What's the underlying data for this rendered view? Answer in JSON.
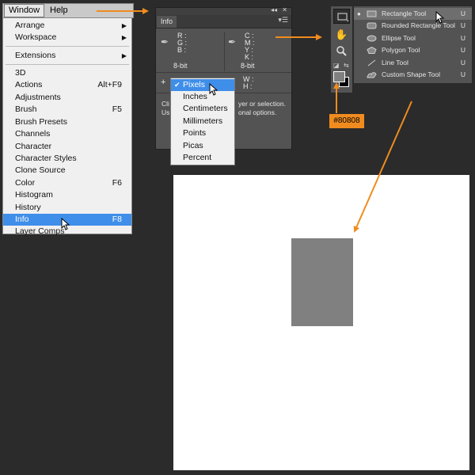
{
  "menubar": {
    "window": "Window",
    "help": "Help"
  },
  "window_menu": {
    "items": [
      {
        "label": "Arrange",
        "underline": "A",
        "submenu": true
      },
      {
        "label": "Workspace",
        "underline": "k",
        "submenu": true
      },
      {
        "label": "Extensions",
        "submenu": true
      },
      {
        "label": "3D"
      },
      {
        "label": "Actions",
        "shortcut": "Alt+F9"
      },
      {
        "label": "Adjustments"
      },
      {
        "label": "Brush",
        "shortcut": "F5"
      },
      {
        "label": "Brush Presets"
      },
      {
        "label": "Channels"
      },
      {
        "label": "Character"
      },
      {
        "label": "Character Styles"
      },
      {
        "label": "Clone Source"
      },
      {
        "label": "Color",
        "shortcut": "F6"
      },
      {
        "label": "Histogram"
      },
      {
        "label": "History"
      },
      {
        "label": "Info",
        "shortcut": "F8",
        "selected": true
      },
      {
        "label": "Layer Comps"
      }
    ]
  },
  "info_panel": {
    "tab": "Info",
    "rgb": {
      "r": "R :",
      "g": "G :",
      "b": "B :"
    },
    "cmyk": {
      "c": "C :",
      "m": "M :",
      "y": "Y :",
      "k": "K :"
    },
    "bit_left": "8-bit",
    "bit_right": "8-bit",
    "wh": {
      "w": "W :",
      "h": "H :"
    },
    "desc_line1_left": "Cli",
    "desc_line1_right": "yer or selection.",
    "desc_line2_left": "Us",
    "desc_line2_right": "onal options."
  },
  "units_menu": {
    "items": [
      {
        "label": "Pixels",
        "checked": true
      },
      {
        "label": "Inches"
      },
      {
        "label": "Centimeters"
      },
      {
        "label": "Millimeters"
      },
      {
        "label": "Points"
      },
      {
        "label": "Picas"
      },
      {
        "label": "Percent"
      }
    ]
  },
  "tool_flyout": {
    "items": [
      {
        "label": "Rectangle Tool",
        "key": "U",
        "selected": true,
        "icon": "rectangle-icon"
      },
      {
        "label": "Rounded Rectangle Tool",
        "key": "U",
        "icon": "rounded-rectangle-icon"
      },
      {
        "label": "Ellipse Tool",
        "key": "U",
        "icon": "ellipse-icon"
      },
      {
        "label": "Polygon Tool",
        "key": "U",
        "icon": "polygon-icon"
      },
      {
        "label": "Line Tool",
        "key": "U",
        "icon": "line-icon"
      },
      {
        "label": "Custom Shape Tool",
        "key": "U",
        "icon": "custom-shape-icon"
      }
    ]
  },
  "color_badge": "#80808",
  "colors": {
    "foreground": "#808080",
    "background": "#000000",
    "accent_arrow": "#f08c1f",
    "menu_highlight": "#3f8ee9"
  }
}
